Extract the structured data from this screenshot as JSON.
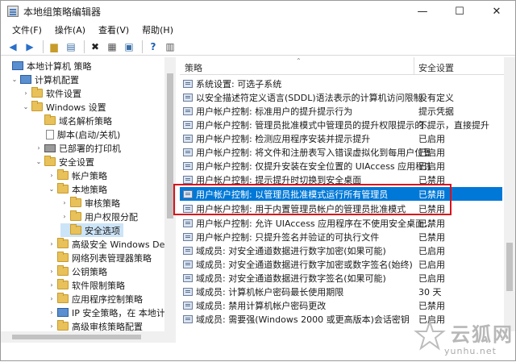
{
  "window": {
    "title": "本地组策略编辑器"
  },
  "controls": {
    "minimize": "—",
    "maximize": "☐",
    "close": "✕"
  },
  "menu": [
    "文件(F)",
    "操作(A)",
    "查看(V)",
    "帮助(H)"
  ],
  "tree": {
    "items": [
      {
        "label": "本地计算机 策略",
        "level": 0,
        "icon": "computer",
        "expanded": true
      },
      {
        "label": "计算机配置",
        "level": 1,
        "icon": "computer",
        "expanded": true
      },
      {
        "label": "软件设置",
        "level": 2,
        "icon": "folder",
        "expanded": false
      },
      {
        "label": "Windows 设置",
        "level": 2,
        "icon": "folder",
        "expanded": true
      },
      {
        "label": "域名解析策略",
        "level": 3,
        "icon": "folder",
        "expanded": null
      },
      {
        "label": "脚本(启动/关机)",
        "level": 3,
        "icon": "doc",
        "expanded": null
      },
      {
        "label": "已部署的打印机",
        "level": 3,
        "icon": "printer",
        "expanded": false
      },
      {
        "label": "安全设置",
        "level": 3,
        "icon": "folder",
        "expanded": true
      },
      {
        "label": "帐户策略",
        "level": 4,
        "icon": "folder",
        "expanded": false
      },
      {
        "label": "本地策略",
        "level": 4,
        "icon": "folder",
        "expanded": true
      },
      {
        "label": "审核策略",
        "level": 5,
        "icon": "folder",
        "expanded": null
      },
      {
        "label": "用户权限分配",
        "level": 5,
        "icon": "folder",
        "expanded": null
      },
      {
        "label": "安全选项",
        "level": 5,
        "icon": "folder",
        "expanded": null,
        "selected": true
      },
      {
        "label": "高级安全 Windows Defe",
        "level": 4,
        "icon": "folder",
        "expanded": false
      },
      {
        "label": "网络列表管理器策略",
        "level": 4,
        "icon": "folder",
        "expanded": null
      },
      {
        "label": "公钥策略",
        "level": 4,
        "icon": "folder",
        "expanded": false
      },
      {
        "label": "软件限制策略",
        "level": 4,
        "icon": "folder",
        "expanded": false
      },
      {
        "label": "应用程序控制策略",
        "level": 4,
        "icon": "folder",
        "expanded": false
      },
      {
        "label": "IP 安全策略，在 本地计",
        "level": 4,
        "icon": "computer",
        "expanded": false
      },
      {
        "label": "高级审核策略配置",
        "level": 4,
        "icon": "folder",
        "expanded": false
      }
    ]
  },
  "list": {
    "columns": {
      "policy": "策略",
      "setting": "安全设置"
    },
    "rows": [
      {
        "name": "系统设置: 可选子系统",
        "value": ""
      },
      {
        "name": "以安全描述符定义语言(SDDL)语法表示的计算机访问限制",
        "value": "没有定义"
      },
      {
        "name": "用户帐户控制: 标准用户的提升提示行为",
        "value": "提示凭据"
      },
      {
        "name": "用户帐户控制: 管理员批准模式中管理员的提升权限提示的...",
        "value": "不提示，直接提升"
      },
      {
        "name": "用户帐户控制: 检测应用程序安装并提示提升",
        "value": "已启用"
      },
      {
        "name": "用户帐户控制: 将文件和注册表写入错误虚拟化到每用户位置",
        "value": "已启用"
      },
      {
        "name": "用户帐户控制: 仅提升安装在安全位置的 UIAccess 应用程序",
        "value": "已启用"
      },
      {
        "name": "用户帐户控制: 提示提升时切换到安全桌面",
        "value": "已禁用"
      },
      {
        "name": "用户帐户控制: 以管理员批准模式运行所有管理员",
        "value": "已禁用",
        "selected": true
      },
      {
        "name": "用户帐户控制: 用于内置管理员帐户的管理员批准模式",
        "value": "已禁用"
      },
      {
        "name": "用户帐户控制: 允许 UIAccess 应用程序在不使用安全桌面...",
        "value": "已禁用"
      },
      {
        "name": "用户帐户控制: 只提升签名并验证的可执行文件",
        "value": "已禁用"
      },
      {
        "name": "域成员: 对安全通道数据进行数字加密(如果可能)",
        "value": "已启用"
      },
      {
        "name": "域成员: 对安全通道数据进行数字加密或数字签名(始终)",
        "value": "已启用"
      },
      {
        "name": "域成员: 对安全通道数据进行数字签名(如果可能)",
        "value": "已启用"
      },
      {
        "name": "域成员: 计算机帐户密码最长使用期限",
        "value": "30 天"
      },
      {
        "name": "域成员: 禁用计算机帐户密码更改",
        "value": "已禁用"
      },
      {
        "name": "域成员: 需要强(Windows 2000 或更高版本)会话密钥",
        "value": "已启用"
      }
    ]
  },
  "watermark": {
    "text": "云狐网",
    "url": "yunhu.net"
  },
  "colors": {
    "selection": "#0078d7",
    "highlight_box": "#d9121b",
    "tree_selection": "#cce4f7"
  }
}
